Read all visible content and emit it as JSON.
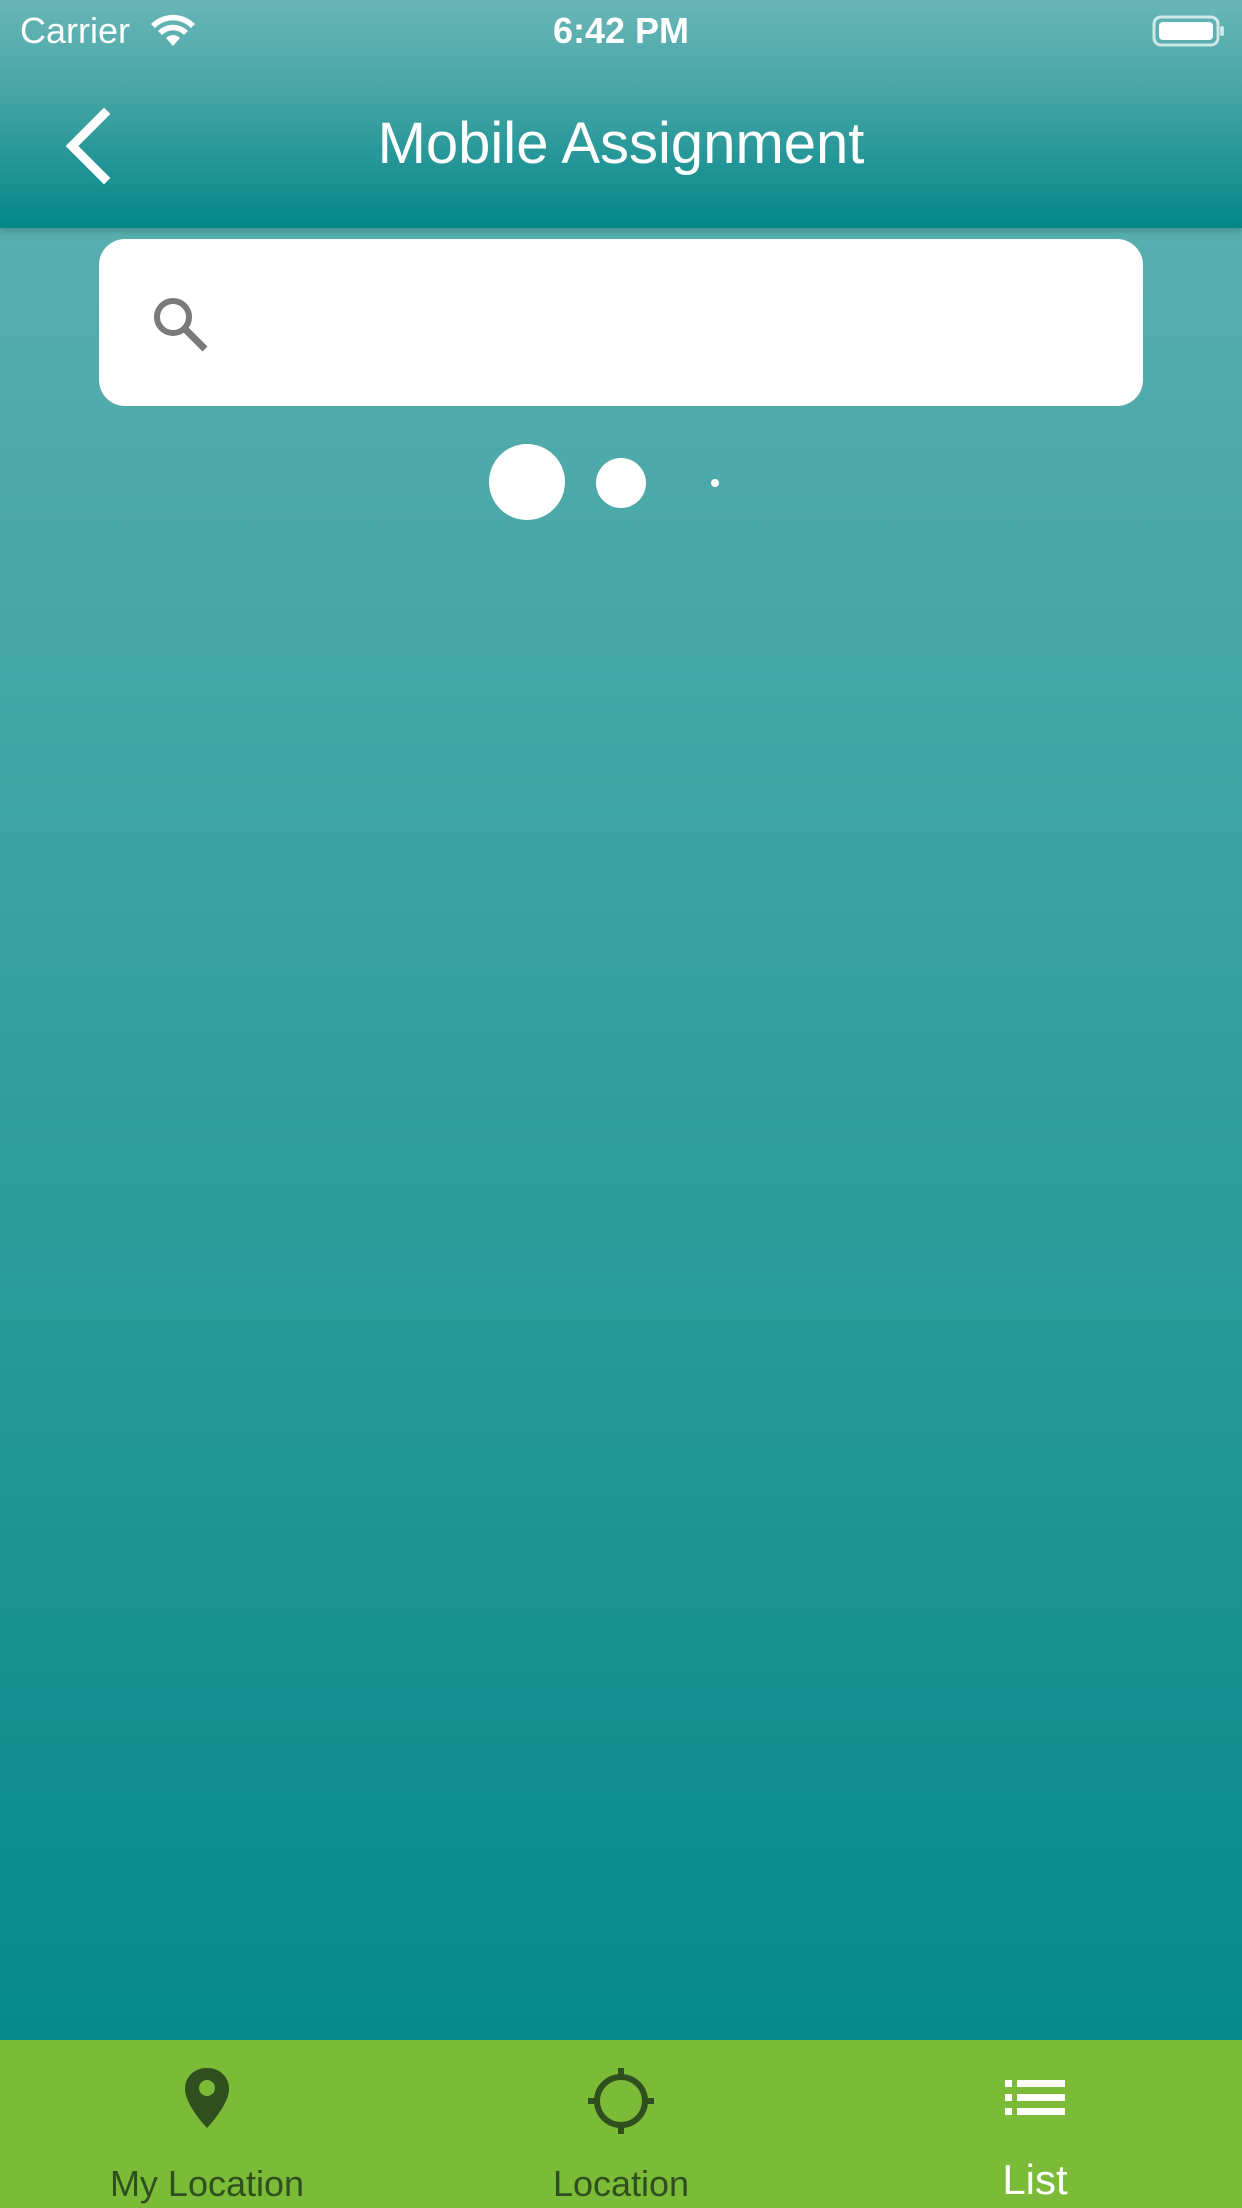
{
  "status_bar": {
    "carrier": "Carrier",
    "time": "6:42 PM",
    "wifi_icon": "wifi-icon",
    "battery_icon": "battery-icon"
  },
  "header": {
    "title": "Mobile Assignment",
    "back_icon": "chevron-left-icon"
  },
  "search": {
    "icon": "search-icon",
    "value": "",
    "placeholder": ""
  },
  "loader": {
    "icon": "loading-dots"
  },
  "tab_bar": {
    "active_index": 2,
    "tabs": [
      {
        "label": "My Location",
        "icon": "map-pin-icon"
      },
      {
        "label": "Location",
        "icon": "crosshair-icon"
      },
      {
        "label": "List",
        "icon": "list-icon"
      }
    ]
  },
  "colors": {
    "header_top": "#6ab6b7",
    "header_bottom": "#028687",
    "background_top": "#62b2b2",
    "background_bottom": "#028686",
    "tab_bar": "#7bbb37",
    "tab_inactive": "#2f4f1f",
    "tab_active": "#ffffff"
  }
}
